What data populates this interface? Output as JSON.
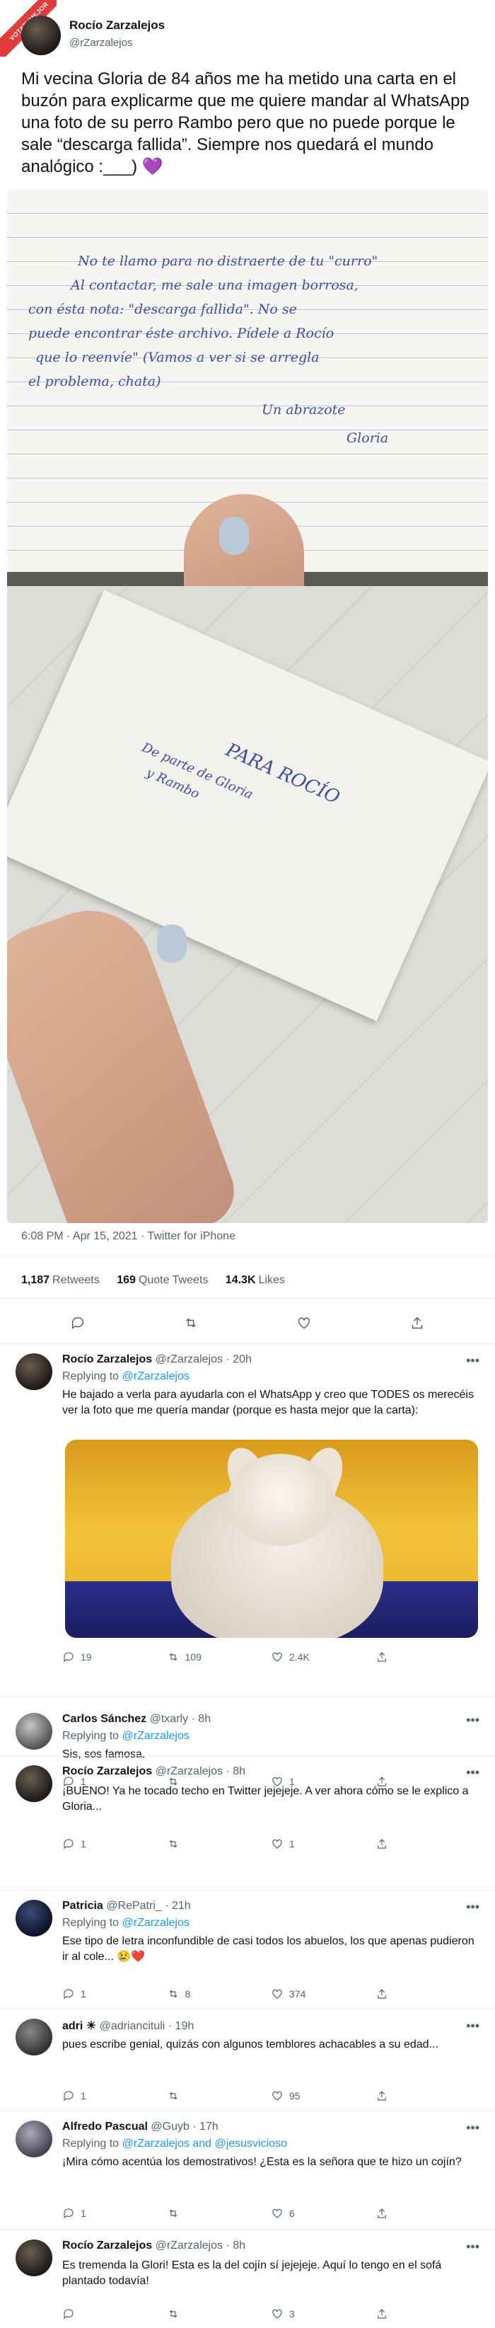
{
  "badge": "VOTATUMEJOR",
  "tweet": {
    "name": "Rocío Zarzalejos",
    "handle": "@rZarzalejos",
    "text": "Mi vecina Gloria de 84 años me ha metido una carta en el buzón para explicarme que me quiere mandar al WhatsApp una foto de su perro Rambo pero que no puede porque le sale “descarga fallida”. Siempre nos quedará el mundo analógico :___) 💜",
    "letter_lines": [
      "No te llamo para no distraerte de tu \"curro\"",
      "Al contactar, me sale una imagen borrosa,",
      "con ésta nota: \"descarga fallida\". No se",
      "puede encontrar éste archivo. Pídele a Rocío",
      "que lo reenvíe\" (Vamos a ver si se arregla",
      "el problema, chata)",
      "Un abrazote",
      "Gloria"
    ],
    "envelope_lines": [
      "PARA ROCÍO",
      "De parte de Gloria",
      "y Rambo"
    ],
    "meta": "6:08 PM · Apr 15, 2021 · Twitter for iPhone",
    "stats": {
      "retweets_value": "1,187",
      "retweets_label": "Retweets",
      "quotes_value": "169",
      "quotes_label": "Quote Tweets",
      "likes_value": "14.3K",
      "likes_label": "Likes"
    }
  },
  "replies": [
    {
      "name": "Rocío Zarzalejos",
      "meta": "@rZarzalejos · 20h",
      "replying_label": "Replying to",
      "replying_to": "@rZarzalejos",
      "text": "He bajado a verla para ayudarla con el WhatsApp y creo que TODES os merecéis ver la foto que me quería mandar (porque es hasta mejor que la carta):",
      "replies": "19",
      "retweets": "109",
      "likes": "2.4K"
    },
    {
      "name": "Carlos Sánchez",
      "meta": "@txarly · 8h",
      "replying_label": "Replying to",
      "replying_to": "@rZarzalejos",
      "text": "Sis, sos famosa.",
      "replies": "1",
      "retweets": "",
      "likes": "1"
    },
    {
      "name": "Rocío Zarzalejos",
      "meta": "@rZarzalejos · 8h",
      "text": "¡BUENO! Ya he tocado techo en Twitter jejejeje. A ver ahora cómo se le explico a Gloria...",
      "replies": "1",
      "retweets": "",
      "likes": "1"
    },
    {
      "name": "Patricia",
      "meta": "@RePatri_ · 21h",
      "replying_label": "Replying to",
      "replying_to": "@rZarzalejos",
      "text": "Ese tipo de letra inconfundible de casi todos los abuelos, los que apenas pudieron ir al cole... 😢❤️",
      "replies": "1",
      "retweets": "8",
      "likes": "374"
    },
    {
      "name": "adri ☀",
      "meta": "@adriancituli · 19h",
      "text": "pues escribe genial, quizás con algunos temblores achacables a su edad...",
      "replies": "1",
      "retweets": "",
      "likes": "95"
    },
    {
      "name": "Alfredo Pascual",
      "meta": "@Guyb · 17h",
      "replying_label": "Replying to",
      "replying_to": "@rZarzalejos and @jesusvicioso",
      "text": "¡Mira cómo acentúa los demostrativos! ¿Esta es la señora que te hizo un cojín?",
      "replies": "1",
      "retweets": "",
      "likes": "6"
    },
    {
      "name": "Rocío Zarzalejos",
      "meta": "@rZarzalejos · 8h",
      "text": "Es tremenda la Glori! Esta es la del cojín sí jejejeje. Aquí lo tengo en el sofá plantado todavía!",
      "replies": "",
      "retweets": "",
      "likes": "3"
    }
  ],
  "colors": {
    "link": "#1d9bf0",
    "muted": "#536471",
    "ink": "#3d4fa0"
  }
}
